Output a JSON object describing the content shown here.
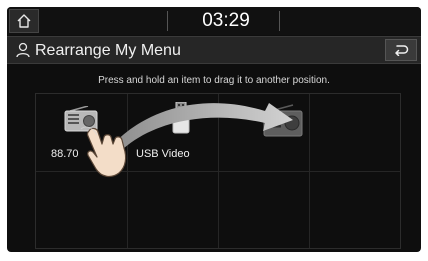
{
  "statusbar": {
    "time": "03:29"
  },
  "titlebar": {
    "title": "Rearrange My Menu"
  },
  "instruction": "Press and hold an item to drag it to another position.",
  "items": [
    {
      "label": "88.70",
      "icon": "radio-icon"
    },
    {
      "label": "USB Video",
      "icon": "usb-icon"
    }
  ],
  "drag_target": {
    "icon": "radio-icon"
  },
  "colors": {
    "background": "#0e0e0e",
    "titlebar": "#262626",
    "text": "#f0f0f0"
  }
}
